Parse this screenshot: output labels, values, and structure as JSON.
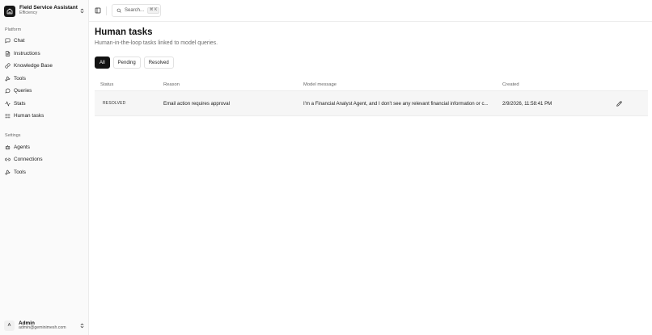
{
  "app": {
    "title": "Field Service Assistant",
    "subtitle": "Efficiency"
  },
  "sidebar": {
    "platform_label": "Platform",
    "platform_items": [
      {
        "label": "Chat",
        "icon": "message-square-icon"
      },
      {
        "label": "Instructions",
        "icon": "file-text-icon"
      },
      {
        "label": "Knowledge Base",
        "icon": "link-icon"
      },
      {
        "label": "Tools",
        "icon": "wrench-icon"
      },
      {
        "label": "Queries",
        "icon": "message-circle-icon"
      },
      {
        "label": "Stats",
        "icon": "activity-icon"
      },
      {
        "label": "Human tasks",
        "icon": "list-checks-icon"
      }
    ],
    "settings_label": "Settings",
    "settings_items": [
      {
        "label": "Agents",
        "icon": "bot-icon"
      },
      {
        "label": "Connections",
        "icon": "link-2-icon"
      },
      {
        "label": "Tools",
        "icon": "wrench-icon"
      }
    ]
  },
  "user": {
    "initial": "A",
    "name": "Admin",
    "email": "admin@geminimesh.com"
  },
  "topbar": {
    "search_placeholder": "Search...",
    "search_shortcut": "⌘ K"
  },
  "page": {
    "title": "Human tasks",
    "subtitle": "Human-in-the-loop tasks linked to model queries."
  },
  "filters": {
    "all": "All",
    "pending": "Pending",
    "resolved": "Resolved",
    "active": "All"
  },
  "table": {
    "headers": {
      "status": "Status",
      "reason": "Reason",
      "model_message": "Model message",
      "created": "Created"
    },
    "rows": [
      {
        "status": "RESOLVED",
        "reason": "Email action requires approval",
        "model_message": "I'm a Financial Analyst Agent, and I don't see any relevant financial information or c...",
        "created": "2/9/2026, 11:58:41 PM"
      }
    ]
  },
  "colors": {
    "accent": "#121212",
    "sidebar_bg": "#fafafa",
    "row_bg": "#f6f6f6"
  }
}
